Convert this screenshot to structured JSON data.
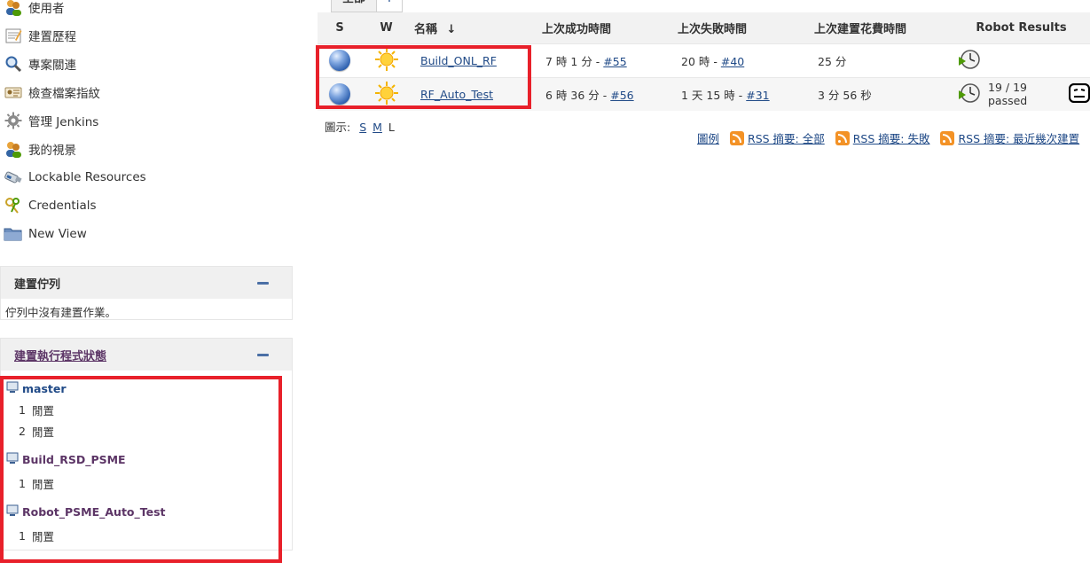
{
  "sidebar": {
    "tasks": [
      {
        "label": "使用者",
        "icon": "people-icon"
      },
      {
        "label": "建置歷程",
        "icon": "notepad-icon"
      },
      {
        "label": "專案關連",
        "icon": "search-icon"
      },
      {
        "label": "檢查檔案指紋",
        "icon": "fingerprint-icon"
      },
      {
        "label": "管理 Jenkins",
        "icon": "gear-icon"
      },
      {
        "label": "我的視景",
        "icon": "people-icon"
      },
      {
        "label": "Lockable Resources",
        "icon": "usb-drive-icon"
      },
      {
        "label": "Credentials",
        "icon": "keys-icon"
      },
      {
        "label": "New View",
        "icon": "folder-icon"
      }
    ]
  },
  "build_queue": {
    "title": "建置佇列",
    "empty_text": "佇列中沒有建置作業。"
  },
  "executor_status": {
    "title": "建置執行程式狀態",
    "nodes": [
      {
        "name": "master",
        "executors": [
          {
            "num": "1",
            "state": "閒置"
          },
          {
            "num": "2",
            "state": "閒置"
          }
        ]
      },
      {
        "name": "Build_RSD_PSME",
        "executors": [
          {
            "num": "1",
            "state": "閒置"
          }
        ]
      },
      {
        "name": "Robot_PSME_Auto_Test",
        "executors": [
          {
            "num": "1",
            "state": "閒置"
          }
        ]
      }
    ]
  },
  "tabs": {
    "all_label": "全部",
    "add_label": "+"
  },
  "jobs_table": {
    "headers": {
      "status": "S",
      "weather": "W",
      "name": "名稱",
      "sort_arrow": "↓",
      "last_success": "上次成功時間",
      "last_failure": "上次失敗時間",
      "last_duration": "上次建置花費時間",
      "robot": "Robot Results"
    },
    "rows": [
      {
        "name": "Build_ONL_RF",
        "status_color": "blue",
        "weather": "sunny-icon",
        "last_success": "7 時 1 分 - ",
        "last_success_link": "#55",
        "last_failure": "20 時 - ",
        "last_failure_link": "#40",
        "last_duration": "25 分",
        "robot_passed": ""
      },
      {
        "name": "RF_Auto_Test",
        "status_color": "blue",
        "weather": "sunny-icon",
        "last_success": "6 時 36 分 - ",
        "last_success_link": "#56",
        "last_failure": "1 天 15 時 - ",
        "last_failure_link": "#31",
        "last_duration": "3 分 56 秒",
        "robot_passed": "19 / 19 passed"
      }
    ]
  },
  "icon_size": {
    "label": "圖示:",
    "small": "S",
    "medium": "M",
    "large": "L"
  },
  "footer": {
    "legend": "圖例",
    "rss_all": "RSS 摘要: 全部",
    "rss_failed": "RSS 摘要: 失敗",
    "rss_latest": "RSS 摘要: 最近幾次建置"
  },
  "colors": {
    "highlight": "#e8202a",
    "link": "#204a87",
    "visited": "#5c3566",
    "rss": "#f39226"
  }
}
